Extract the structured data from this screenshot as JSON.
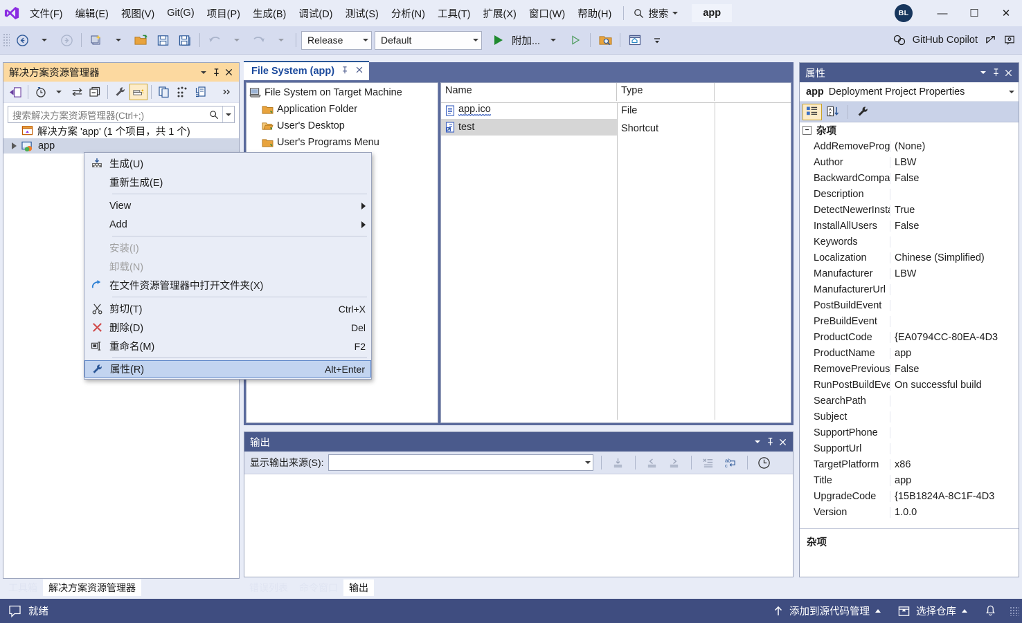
{
  "window": {
    "app_chip": "app",
    "avatar_initials": "BL",
    "minimize": "—",
    "maximize": "☐",
    "close": "✕"
  },
  "menubar": {
    "items": [
      {
        "label": "文件(F)"
      },
      {
        "label": "编辑(E)"
      },
      {
        "label": "视图(V)"
      },
      {
        "label": "Git(G)"
      },
      {
        "label": "项目(P)"
      },
      {
        "label": "生成(B)"
      },
      {
        "label": "调试(D)"
      },
      {
        "label": "测试(S)"
      },
      {
        "label": "分析(N)"
      },
      {
        "label": "工具(T)"
      },
      {
        "label": "扩展(X)"
      },
      {
        "label": "窗口(W)"
      },
      {
        "label": "帮助(H)"
      }
    ],
    "search_label": "搜索"
  },
  "toolbar": {
    "configuration": "Release",
    "platform": "Default",
    "attach_label": "附加...",
    "copilot_label": "GitHub Copilot"
  },
  "solution_explorer": {
    "title": "解决方案资源管理器",
    "search_placeholder": "搜索解决方案资源管理器(Ctrl+;)",
    "solution_node": "解决方案 'app' (1 个项目，共 1 个)",
    "project_node": "app"
  },
  "context_menu": {
    "items": [
      {
        "label": "生成(U)",
        "key": "",
        "icon": "build-icon",
        "state": "normal",
        "submenu": false
      },
      {
        "label": "重新生成(E)",
        "key": "",
        "icon": "",
        "state": "normal",
        "submenu": false
      },
      {
        "separator": true
      },
      {
        "label": "View",
        "key": "",
        "icon": "",
        "state": "normal",
        "submenu": true
      },
      {
        "label": "Add",
        "key": "",
        "icon": "",
        "state": "normal",
        "submenu": true
      },
      {
        "separator": true
      },
      {
        "label": "安装(I)",
        "key": "",
        "icon": "",
        "state": "disabled",
        "submenu": false
      },
      {
        "label": "卸载(N)",
        "key": "",
        "icon": "",
        "state": "disabled",
        "submenu": false
      },
      {
        "label": "在文件资源管理器中打开文件夹(X)",
        "key": "",
        "icon": "open-folder-arrow-icon",
        "state": "normal",
        "submenu": false
      },
      {
        "separator": true
      },
      {
        "label": "剪切(T)",
        "key": "Ctrl+X",
        "icon": "scissors-icon",
        "state": "normal",
        "submenu": false
      },
      {
        "label": "删除(D)",
        "key": "Del",
        "icon": "delete-x-icon",
        "state": "normal",
        "submenu": false
      },
      {
        "label": "重命名(M)",
        "key": "F2",
        "icon": "rename-icon",
        "state": "normal",
        "submenu": false
      },
      {
        "separator": true
      },
      {
        "label": "属性(R)",
        "key": "Alt+Enter",
        "icon": "wrench-icon",
        "state": "highlighted",
        "submenu": false
      }
    ]
  },
  "filesystem": {
    "tab_label": "File System (app)",
    "tree": [
      {
        "label": "File System on Target Machine",
        "icon": "computer-icon",
        "indent": 0
      },
      {
        "label": "Application Folder",
        "icon": "folder-icon",
        "indent": 1
      },
      {
        "label": "User's Desktop",
        "icon": "folder-open-icon",
        "indent": 1
      },
      {
        "label": "User's Programs Menu",
        "icon": "folder-icon",
        "indent": 1
      }
    ],
    "grid": {
      "columns": [
        "Name",
        "Type"
      ],
      "rows": [
        {
          "name": "app.ico",
          "type": "File",
          "icon": "file-icon",
          "selected": false,
          "squiggle": true
        },
        {
          "name": "test",
          "type": "Shortcut",
          "icon": "shortcut-icon",
          "selected": true,
          "squiggle": false
        }
      ]
    }
  },
  "output": {
    "title": "输出",
    "source_label": "显示输出来源(S):",
    "source_value": ""
  },
  "properties": {
    "title": "属性",
    "object_name": "app",
    "object_type": "Deployment Project Properties",
    "category": "杂项",
    "description_title": "杂项",
    "rows": [
      {
        "name": "AddRemoveProg",
        "value": "(None)"
      },
      {
        "name": "Author",
        "value": "LBW"
      },
      {
        "name": "BackwardCompat",
        "value": "False"
      },
      {
        "name": "Description",
        "value": ""
      },
      {
        "name": "DetectNewerInsta",
        "value": "True"
      },
      {
        "name": "InstallAllUsers",
        "value": "False"
      },
      {
        "name": "Keywords",
        "value": ""
      },
      {
        "name": "Localization",
        "value": "Chinese (Simplified)"
      },
      {
        "name": "Manufacturer",
        "value": "LBW"
      },
      {
        "name": "ManufacturerUrl",
        "value": ""
      },
      {
        "name": "PostBuildEvent",
        "value": ""
      },
      {
        "name": "PreBuildEvent",
        "value": ""
      },
      {
        "name": "ProductCode",
        "value": "{EA0794CC-80EA-4D3"
      },
      {
        "name": "ProductName",
        "value": "app"
      },
      {
        "name": "RemovePrevious\\",
        "value": "False"
      },
      {
        "name": "RunPostBuildEver",
        "value": "On successful build"
      },
      {
        "name": "SearchPath",
        "value": ""
      },
      {
        "name": "Subject",
        "value": ""
      },
      {
        "name": "SupportPhone",
        "value": ""
      },
      {
        "name": "SupportUrl",
        "value": ""
      },
      {
        "name": "TargetPlatform",
        "value": "x86"
      },
      {
        "name": "Title",
        "value": "app"
      },
      {
        "name": "UpgradeCode",
        "value": "{15B1824A-8C1F-4D3"
      },
      {
        "name": "Version",
        "value": "1.0.0"
      }
    ]
  },
  "bottom_tabs": {
    "left": [
      {
        "label": "工具箱",
        "active": false
      },
      {
        "label": "解决方案资源管理器",
        "active": true
      }
    ],
    "middle": [
      {
        "label": "错误列表",
        "active": false
      },
      {
        "label": "命令窗口",
        "active": false
      },
      {
        "label": "输出",
        "active": true
      }
    ]
  },
  "statusbar": {
    "status": "就绪",
    "source_control": "添加到源代码管理",
    "repository": "选择仓库"
  }
}
